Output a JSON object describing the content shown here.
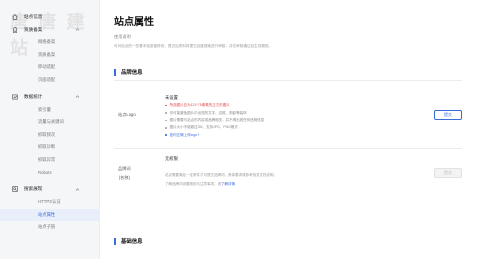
{
  "watermark": "唐 唐 建 站",
  "sidebar": {
    "groups": [
      {
        "label": "站点信息",
        "icon": "home-icon",
        "items": []
      },
      {
        "label": "资质备案",
        "icon": "badge-icon",
        "items": [
          "网络备案",
          "资质备案",
          "移动适配",
          "页面适配"
        ]
      },
      {
        "label": "数据统计",
        "icon": "chart-icon",
        "items": [
          "索引量",
          "流量与关键词",
          "抓取频次",
          "抓取诊断",
          "抓取异常",
          "Robots"
        ]
      },
      {
        "label": "搜索展现",
        "icon": "search-icon",
        "items": [
          "HTTPS认证",
          "站点属性",
          "站点子链"
        ]
      }
    ],
    "active_item": "站点属性"
  },
  "main": {
    "title": "站点属性",
    "desc_title": "使用说明",
    "desc_text": "可对站点的一些基本信息做修改，提交后资料将提交百度搜索进行审核，并在审核通过后生效展现。",
    "brand_section": "品牌信息",
    "logo_label": "站点Logo",
    "logo_status": "未设置",
    "logo_tips": [
      {
        "text": "所选图片应为121*75像素的正方形图片",
        "style": "red"
      },
      {
        "text": "尽可能避免图片中出现的文字、边框、阴影等装饰",
        "style": "gray"
      },
      {
        "text": "图片需要与站点的内容或品牌相关，并不得出现任何违规信息",
        "style": "gray"
      },
      {
        "text": "图片大小不能超过2M，支持JPG、PNG格式",
        "style": "gray"
      },
      {
        "text": "如何正确上传logo?",
        "style": "link"
      }
    ],
    "logo_button": "提交",
    "brand_label": "品牌词",
    "brand_label_sub": "(名称)",
    "brand_status": "无权限",
    "brand_gray_1": "站点需要满足一定条件才可提交品牌词，具体要求请参考相关文档说明。",
    "brand_gray_2": "了解品牌词设置规则与注意事项，请",
    "brand_gray_link": "了解详情",
    "brand_button": "提交",
    "basic_section": "基础信息"
  },
  "colors": {
    "accent": "#3b6cdc",
    "warning": "#e14c4c",
    "sidebar_bg": "#f5f6f8"
  }
}
